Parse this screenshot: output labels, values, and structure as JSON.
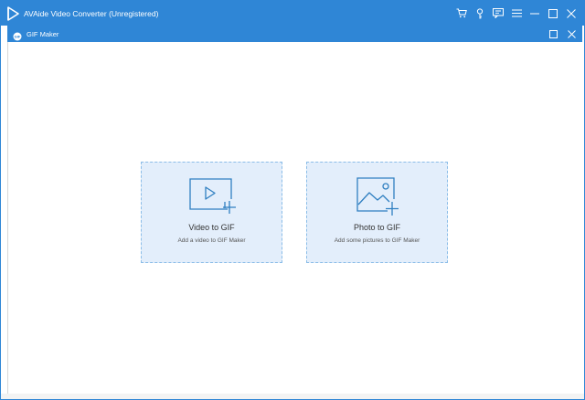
{
  "app": {
    "title": "AVAide Video Converter (Unregistered)",
    "accent_color": "#2f86d6",
    "title_icons": [
      "cart-icon",
      "key-icon",
      "chat-icon",
      "menu-icon",
      "minimize-icon",
      "maximize-icon",
      "close-icon"
    ]
  },
  "subwindow": {
    "title": "GIF Maker",
    "icon": "gif-icon",
    "controls": [
      "maximize-icon",
      "close-icon"
    ]
  },
  "cards": {
    "video": {
      "title": "Video to GIF",
      "subtitle": "Add a video to GIF Maker",
      "icon": "video-add-icon"
    },
    "photo": {
      "title": "Photo to GIF",
      "subtitle": "Add some pictures to GIF Maker",
      "icon": "photo-add-icon"
    }
  }
}
